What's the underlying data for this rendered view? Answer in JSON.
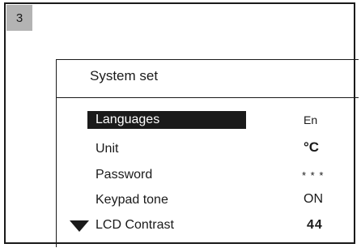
{
  "step_number": "3",
  "screen": {
    "title": "System set",
    "items": [
      {
        "label": "Languages",
        "value": "En"
      },
      {
        "label": "Unit",
        "value": "°C"
      },
      {
        "label": "Password",
        "value": "* * *"
      },
      {
        "label": "Keypad tone",
        "value": "ON"
      },
      {
        "label": "LCD Contrast",
        "value": "44"
      }
    ],
    "selected_item": "Languages",
    "scroll_indicator": "down-triangle-icon"
  }
}
